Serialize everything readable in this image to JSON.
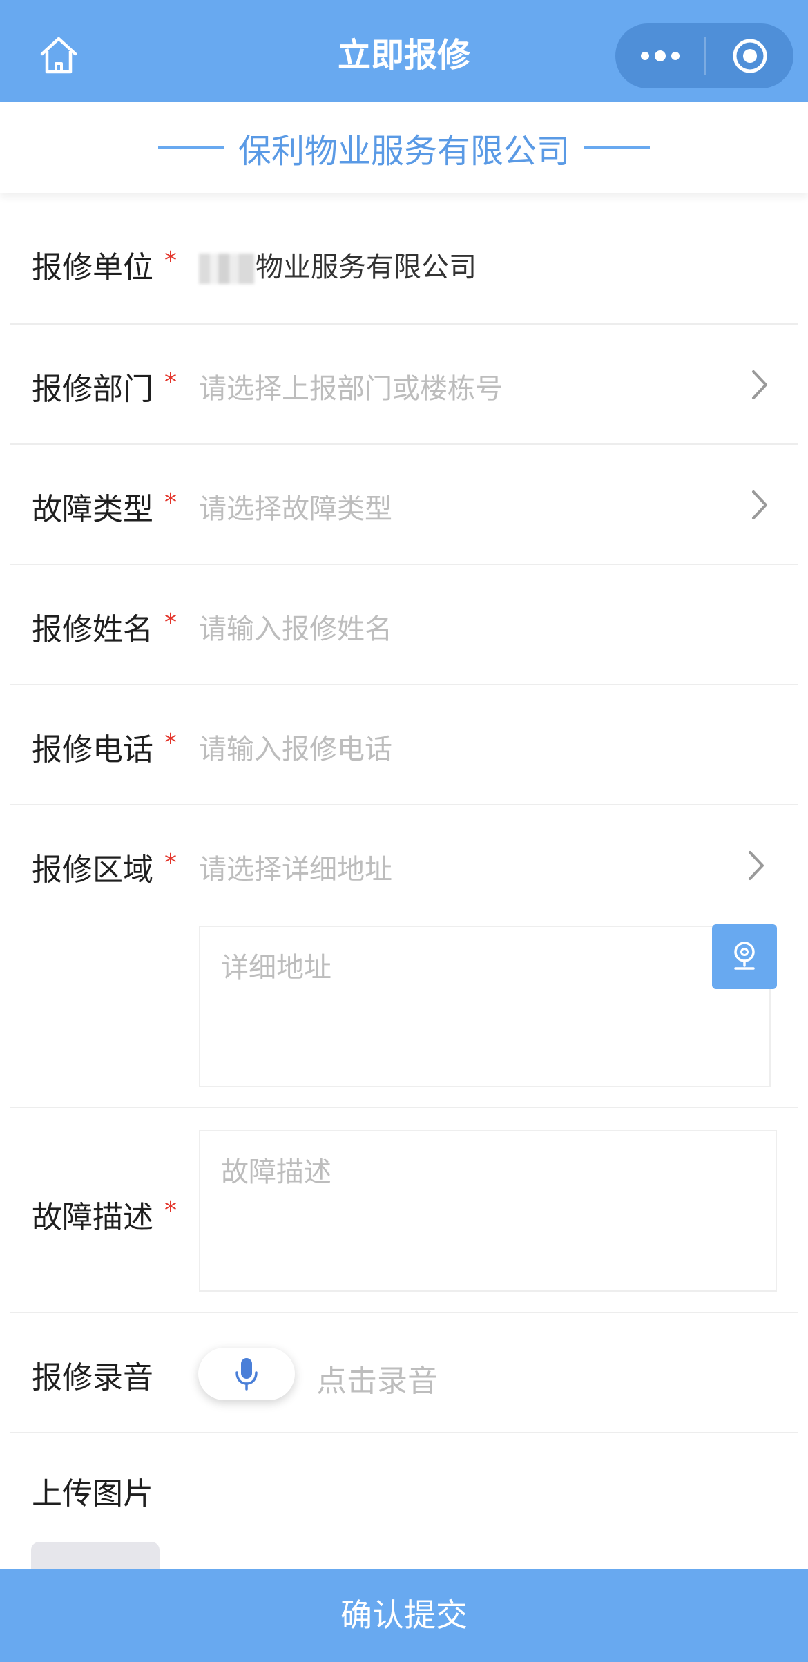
{
  "header": {
    "title": "立即报修",
    "home_icon": "home-icon",
    "more_icon": "more-dots-icon",
    "close_icon": "target-circle-icon",
    "bg_color": "#68a9f0"
  },
  "banner": {
    "company": "保利物业服务有限公司"
  },
  "form": {
    "unit": {
      "label": "报修单位",
      "required": "*",
      "value": "物业服务有限公司"
    },
    "department": {
      "label": "报修部门",
      "required": "*",
      "placeholder": "请选择上报部门或楼栋号"
    },
    "fault_type": {
      "label": "故障类型",
      "required": "*",
      "placeholder": "请选择故障类型"
    },
    "name": {
      "label": "报修姓名",
      "required": "*",
      "placeholder": "请输入报修姓名"
    },
    "phone": {
      "label": "报修电话",
      "required": "*",
      "placeholder": "请输入报修电话"
    },
    "area": {
      "label": "报修区域",
      "required": "*",
      "placeholder": "请选择详细地址",
      "detail_placeholder": "详细地址"
    },
    "description": {
      "label": "故障描述",
      "required": "*",
      "placeholder": "故障描述"
    },
    "recording": {
      "label": "报修录音",
      "hint": "点击录音"
    },
    "upload": {
      "label": "上传图片"
    }
  },
  "submit": {
    "label": "确认提交"
  },
  "colors": {
    "accent": "#68a9f0",
    "required": "#e3352b",
    "placeholder": "#bdbdbd"
  }
}
